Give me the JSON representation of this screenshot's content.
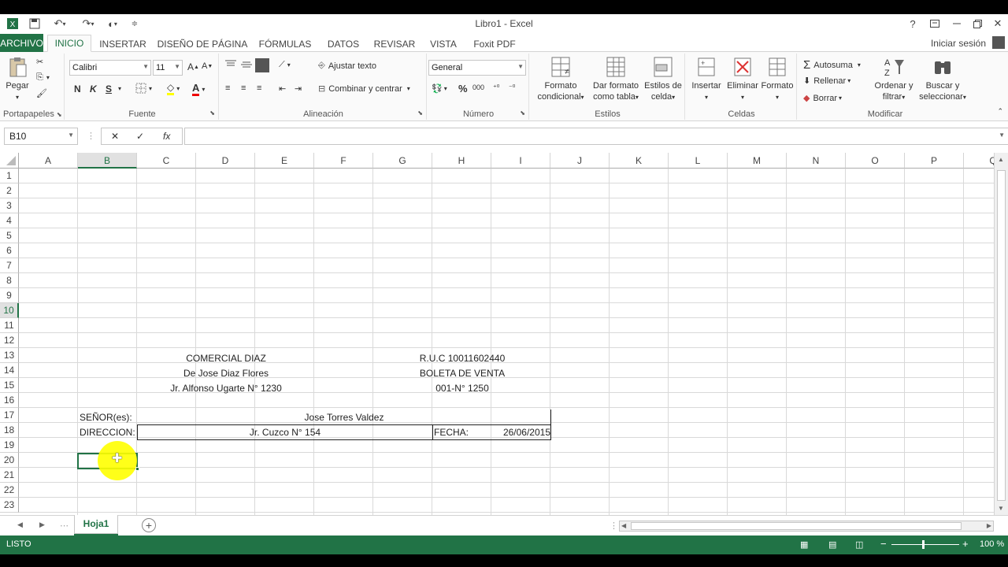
{
  "app": {
    "title": "Libro1 - Excel",
    "help": "?",
    "sign_in": "Iniciar sesión"
  },
  "tabs": [
    "ARCHIVO",
    "INICIO",
    "INSERTAR",
    "DISEÑO DE PÁGINA",
    "FÓRMULAS",
    "DATOS",
    "REVISAR",
    "VISTA",
    "Foxit PDF"
  ],
  "ribbon": {
    "clipboard": {
      "paste": "Pegar",
      "label": "Portapapeles"
    },
    "font": {
      "name": "Calibri",
      "size": "11",
      "bold": "N",
      "italic": "K",
      "underline": "S",
      "label": "Fuente"
    },
    "alignment": {
      "wrap": "Ajustar texto",
      "merge": "Combinar y centrar",
      "label": "Alineación"
    },
    "number": {
      "format": "General",
      "percent": "%",
      "thousands": "000",
      "label": "Número"
    },
    "styles": {
      "conditional": [
        "Formato",
        "condicional"
      ],
      "table": [
        "Dar formato",
        "como tabla"
      ],
      "cell": [
        "Estilos de",
        "celda"
      ],
      "label": "Estilos"
    },
    "cells": {
      "insert": "Insertar",
      "delete": "Eliminar",
      "format": "Formato",
      "label": "Celdas"
    },
    "editing": {
      "autosum": "Autosuma",
      "fill": "Rellenar",
      "clear": "Borrar",
      "sort": [
        "Ordenar y",
        "filtrar"
      ],
      "find": [
        "Buscar y",
        "seleccionar"
      ],
      "label": "Modificar"
    }
  },
  "formula_bar": {
    "name_box": "B10",
    "fx": "fx",
    "content": ""
  },
  "grid": {
    "columns": [
      "A",
      "B",
      "C",
      "D",
      "E",
      "F",
      "G",
      "H",
      "I",
      "J",
      "K",
      "L",
      "M",
      "N",
      "O",
      "P",
      "Q"
    ],
    "rows": [
      "1",
      "2",
      "3",
      "4",
      "5",
      "6",
      "7",
      "8",
      "9",
      "10",
      "11",
      "12",
      "13",
      "14",
      "15",
      "16",
      "17",
      "18",
      "19",
      "20",
      "21",
      "22",
      "23"
    ],
    "active_cell": "B10",
    "cells": {
      "r3_left": "COMERCIAL DIAZ",
      "r3_right": "R.U.C 10011602440",
      "r4_left": "De Jose Diaz Flores",
      "r4_right": "BOLETA DE VENTA",
      "r5_left": "Jr. Alfonso Ugarte N° 1230",
      "r5_right": "001-N° 1250",
      "r7_label": "SEÑOR(es):",
      "r7_value": "Jose Torres Valdez",
      "r8_label": "DIRECCION:",
      "r8_value": "Jr. Cuzco N° 154",
      "r8_date_label": "FECHA:",
      "r8_date_value": "26/06/2015"
    }
  },
  "sheet_tabs": {
    "active": "Hoja1"
  },
  "status": {
    "mode": "LISTO",
    "zoom": "100 %"
  },
  "colors": {
    "accent": "#217346",
    "cursor_highlight": "#ffff00"
  }
}
